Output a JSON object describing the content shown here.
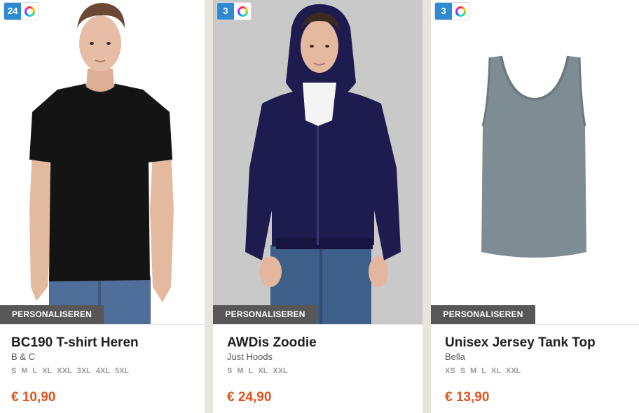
{
  "products": [
    {
      "color_count": "24",
      "personalize_label": "PERSONALISEREN",
      "title": "BC190 T-shirt Heren",
      "brand": "B & C",
      "sizes": [
        "S",
        "M",
        "L",
        "XL",
        "XXL",
        "3XL",
        "4XL",
        "5XL"
      ],
      "price": "€ 10,90",
      "image_icon": "black-tshirt-model-photo",
      "garment_color": "#141414"
    },
    {
      "color_count": "3",
      "personalize_label": "PERSONALISEREN",
      "title": "AWDis Zoodie",
      "brand": "Just Hoods",
      "sizes": [
        "S",
        "M",
        "L",
        "XL",
        "XXL"
      ],
      "price": "€ 24,90",
      "image_icon": "navy-hoodie-model-photo",
      "garment_color": "#1e1b4f"
    },
    {
      "color_count": "3",
      "personalize_label": "PERSONALISEREN",
      "title": "Unisex Jersey Tank Top",
      "brand": "Bella",
      "sizes": [
        "XS",
        "S",
        "M",
        "L",
        "XL",
        "XXL"
      ],
      "price": "€ 13,90",
      "image_icon": "grey-tank-top-photo",
      "garment_color": "#7d8d93"
    }
  ],
  "colors": {
    "badge_blue": "#2f8bd1",
    "personalize_bg": "#575757",
    "price": "#e2541b",
    "page_bg": "#e9e5dc"
  }
}
